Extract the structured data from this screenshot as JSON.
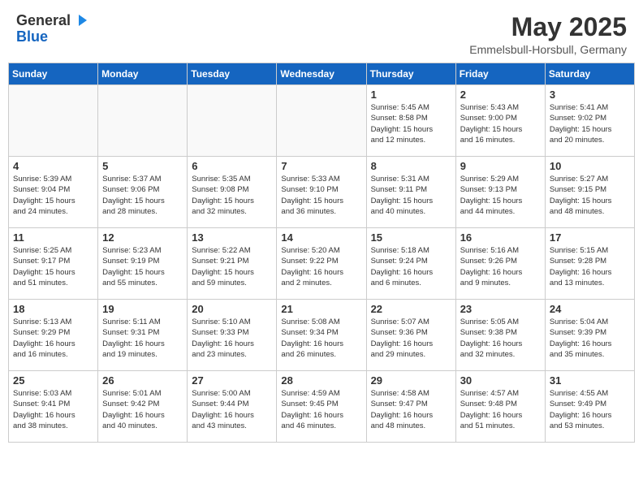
{
  "header": {
    "logo_general": "General",
    "logo_blue": "Blue",
    "month_year": "May 2025",
    "location": "Emmelsbull-Horsbull, Germany"
  },
  "days_of_week": [
    "Sunday",
    "Monday",
    "Tuesday",
    "Wednesday",
    "Thursday",
    "Friday",
    "Saturday"
  ],
  "weeks": [
    [
      {
        "day": "",
        "detail": ""
      },
      {
        "day": "",
        "detail": ""
      },
      {
        "day": "",
        "detail": ""
      },
      {
        "day": "",
        "detail": ""
      },
      {
        "day": "1",
        "detail": "Sunrise: 5:45 AM\nSunset: 8:58 PM\nDaylight: 15 hours\nand 12 minutes."
      },
      {
        "day": "2",
        "detail": "Sunrise: 5:43 AM\nSunset: 9:00 PM\nDaylight: 15 hours\nand 16 minutes."
      },
      {
        "day": "3",
        "detail": "Sunrise: 5:41 AM\nSunset: 9:02 PM\nDaylight: 15 hours\nand 20 minutes."
      }
    ],
    [
      {
        "day": "4",
        "detail": "Sunrise: 5:39 AM\nSunset: 9:04 PM\nDaylight: 15 hours\nand 24 minutes."
      },
      {
        "day": "5",
        "detail": "Sunrise: 5:37 AM\nSunset: 9:06 PM\nDaylight: 15 hours\nand 28 minutes."
      },
      {
        "day": "6",
        "detail": "Sunrise: 5:35 AM\nSunset: 9:08 PM\nDaylight: 15 hours\nand 32 minutes."
      },
      {
        "day": "7",
        "detail": "Sunrise: 5:33 AM\nSunset: 9:10 PM\nDaylight: 15 hours\nand 36 minutes."
      },
      {
        "day": "8",
        "detail": "Sunrise: 5:31 AM\nSunset: 9:11 PM\nDaylight: 15 hours\nand 40 minutes."
      },
      {
        "day": "9",
        "detail": "Sunrise: 5:29 AM\nSunset: 9:13 PM\nDaylight: 15 hours\nand 44 minutes."
      },
      {
        "day": "10",
        "detail": "Sunrise: 5:27 AM\nSunset: 9:15 PM\nDaylight: 15 hours\nand 48 minutes."
      }
    ],
    [
      {
        "day": "11",
        "detail": "Sunrise: 5:25 AM\nSunset: 9:17 PM\nDaylight: 15 hours\nand 51 minutes."
      },
      {
        "day": "12",
        "detail": "Sunrise: 5:23 AM\nSunset: 9:19 PM\nDaylight: 15 hours\nand 55 minutes."
      },
      {
        "day": "13",
        "detail": "Sunrise: 5:22 AM\nSunset: 9:21 PM\nDaylight: 15 hours\nand 59 minutes."
      },
      {
        "day": "14",
        "detail": "Sunrise: 5:20 AM\nSunset: 9:22 PM\nDaylight: 16 hours\nand 2 minutes."
      },
      {
        "day": "15",
        "detail": "Sunrise: 5:18 AM\nSunset: 9:24 PM\nDaylight: 16 hours\nand 6 minutes."
      },
      {
        "day": "16",
        "detail": "Sunrise: 5:16 AM\nSunset: 9:26 PM\nDaylight: 16 hours\nand 9 minutes."
      },
      {
        "day": "17",
        "detail": "Sunrise: 5:15 AM\nSunset: 9:28 PM\nDaylight: 16 hours\nand 13 minutes."
      }
    ],
    [
      {
        "day": "18",
        "detail": "Sunrise: 5:13 AM\nSunset: 9:29 PM\nDaylight: 16 hours\nand 16 minutes."
      },
      {
        "day": "19",
        "detail": "Sunrise: 5:11 AM\nSunset: 9:31 PM\nDaylight: 16 hours\nand 19 minutes."
      },
      {
        "day": "20",
        "detail": "Sunrise: 5:10 AM\nSunset: 9:33 PM\nDaylight: 16 hours\nand 23 minutes."
      },
      {
        "day": "21",
        "detail": "Sunrise: 5:08 AM\nSunset: 9:34 PM\nDaylight: 16 hours\nand 26 minutes."
      },
      {
        "day": "22",
        "detail": "Sunrise: 5:07 AM\nSunset: 9:36 PM\nDaylight: 16 hours\nand 29 minutes."
      },
      {
        "day": "23",
        "detail": "Sunrise: 5:05 AM\nSunset: 9:38 PM\nDaylight: 16 hours\nand 32 minutes."
      },
      {
        "day": "24",
        "detail": "Sunrise: 5:04 AM\nSunset: 9:39 PM\nDaylight: 16 hours\nand 35 minutes."
      }
    ],
    [
      {
        "day": "25",
        "detail": "Sunrise: 5:03 AM\nSunset: 9:41 PM\nDaylight: 16 hours\nand 38 minutes."
      },
      {
        "day": "26",
        "detail": "Sunrise: 5:01 AM\nSunset: 9:42 PM\nDaylight: 16 hours\nand 40 minutes."
      },
      {
        "day": "27",
        "detail": "Sunrise: 5:00 AM\nSunset: 9:44 PM\nDaylight: 16 hours\nand 43 minutes."
      },
      {
        "day": "28",
        "detail": "Sunrise: 4:59 AM\nSunset: 9:45 PM\nDaylight: 16 hours\nand 46 minutes."
      },
      {
        "day": "29",
        "detail": "Sunrise: 4:58 AM\nSunset: 9:47 PM\nDaylight: 16 hours\nand 48 minutes."
      },
      {
        "day": "30",
        "detail": "Sunrise: 4:57 AM\nSunset: 9:48 PM\nDaylight: 16 hours\nand 51 minutes."
      },
      {
        "day": "31",
        "detail": "Sunrise: 4:55 AM\nSunset: 9:49 PM\nDaylight: 16 hours\nand 53 minutes."
      }
    ]
  ]
}
